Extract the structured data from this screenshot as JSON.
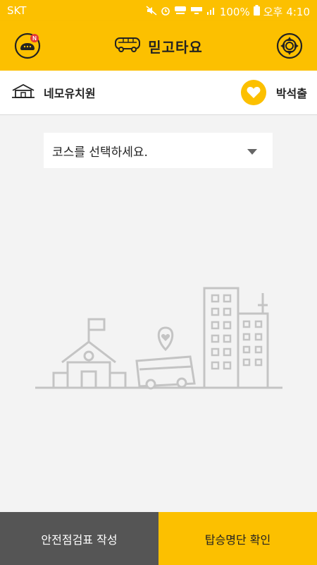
{
  "status_bar": {
    "carrier": "SKT",
    "battery": "100%",
    "ampm": "오후",
    "time": "4:10",
    "icons": [
      "mute-icon",
      "alarm-icon",
      "hd-voice-icon",
      "lte-icon",
      "signal-icon",
      "battery-icon"
    ]
  },
  "app_bar": {
    "title": "믿고타요",
    "left_icon": "notice-chat-icon",
    "title_icon": "bus-icon",
    "right_icon": "gear-icon",
    "badge": "N"
  },
  "info_bar": {
    "school_name": "네모유치원",
    "user_name": "박석출",
    "school_icon": "school-icon",
    "user_icon": "heart-icon"
  },
  "course_select": {
    "placeholder": "코스를 선택하세요."
  },
  "illustration": {
    "icon": "town-illustration"
  },
  "bottom_bar": {
    "left_label": "안전점검표 작성",
    "right_label": "탑승명단 확인"
  },
  "colors": {
    "accent": "#fcc000",
    "dark_button": "#555555",
    "background": "#f3f3f3"
  }
}
